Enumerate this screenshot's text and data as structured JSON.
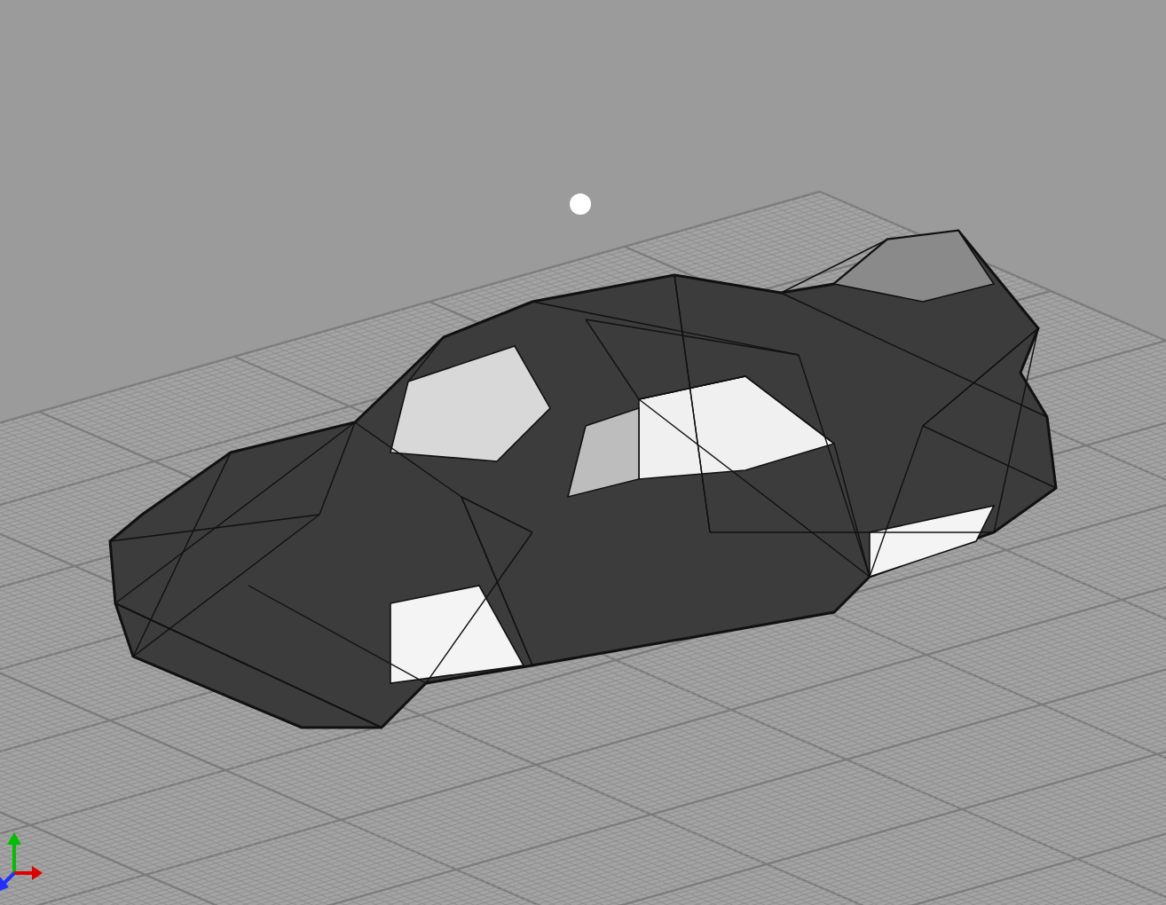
{
  "viewport": {
    "grid_visible": true,
    "light_visible": true,
    "axis_gizmo_visible": true
  }
}
